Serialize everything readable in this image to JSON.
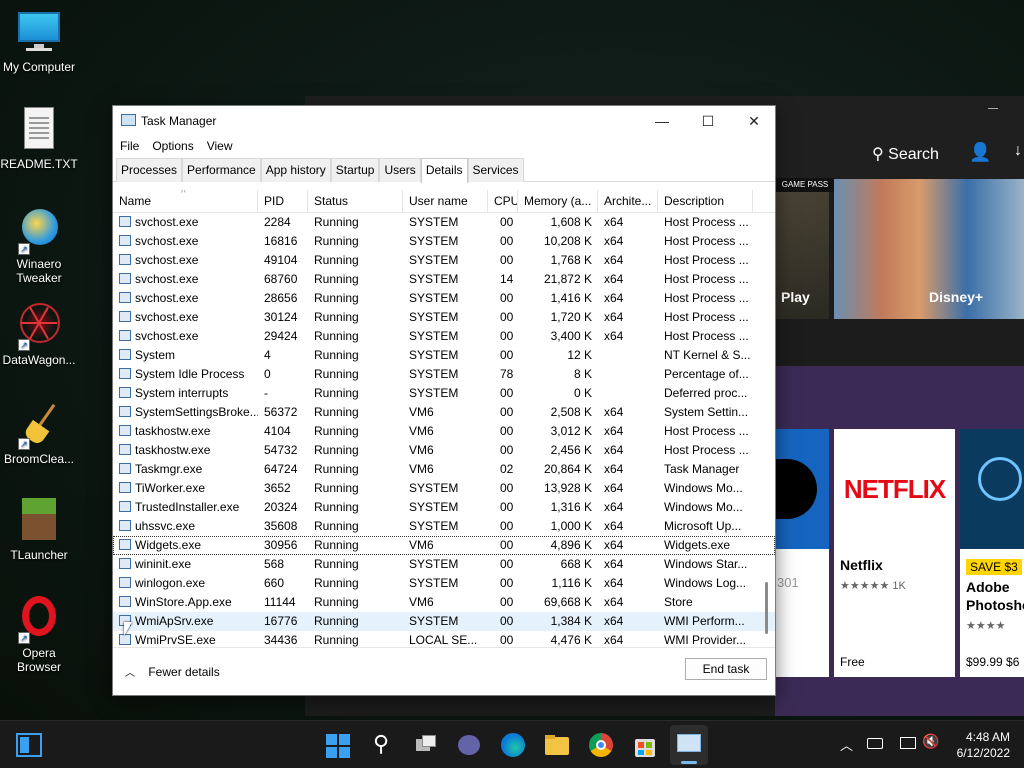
{
  "desktop": {
    "icons": [
      {
        "label": "My Computer"
      },
      {
        "label": "README.TXT"
      },
      {
        "label": "Winaero Tweaker"
      },
      {
        "label": "DataWagon..."
      },
      {
        "label": "BroomClea..."
      },
      {
        "label": "TLauncher"
      },
      {
        "label": "Opera Browser"
      }
    ]
  },
  "store": {
    "search_label": "Search",
    "gamepass_label": "GAME PASS",
    "hero_play": "Play",
    "hero_disney": "Disney+",
    "tile_netflix_logo": "NETFLIX",
    "tile_netflix_name": "Netflix",
    "tile_netflix_rating": "★★★★★ 1K",
    "tile_netflix_price": "Free",
    "tile_adobe_badge": "SAVE $3",
    "tile_adobe_name": "Adobe",
    "tile_adobe_name2": "Photosho",
    "tile_adobe_rating": "★★★★",
    "tile_adobe_price": "$99.99 $6",
    "tile_tiktok_partial": "301"
  },
  "taskmanager": {
    "title": "Task Manager",
    "menu": [
      "File",
      "Options",
      "View"
    ],
    "tabs": [
      "Processes",
      "Performance",
      "App history",
      "Startup",
      "Users",
      "Details",
      "Services"
    ],
    "active_tab": "Details",
    "columns": [
      "Name",
      "PID",
      "Status",
      "User name",
      "CPU",
      "Memory (a...",
      "Archite...",
      "Description"
    ],
    "rows": [
      [
        "svchost.exe",
        "2284",
        "Running",
        "SYSTEM",
        "00",
        "1,608 K",
        "x64",
        "Host Process ..."
      ],
      [
        "svchost.exe",
        "16816",
        "Running",
        "SYSTEM",
        "00",
        "10,208 K",
        "x64",
        "Host Process ..."
      ],
      [
        "svchost.exe",
        "49104",
        "Running",
        "SYSTEM",
        "00",
        "1,768 K",
        "x64",
        "Host Process ..."
      ],
      [
        "svchost.exe",
        "68760",
        "Running",
        "SYSTEM",
        "14",
        "21,872 K",
        "x64",
        "Host Process ..."
      ],
      [
        "svchost.exe",
        "28656",
        "Running",
        "SYSTEM",
        "00",
        "1,416 K",
        "x64",
        "Host Process ..."
      ],
      [
        "svchost.exe",
        "30124",
        "Running",
        "SYSTEM",
        "00",
        "1,720 K",
        "x64",
        "Host Process ..."
      ],
      [
        "svchost.exe",
        "29424",
        "Running",
        "SYSTEM",
        "00",
        "3,400 K",
        "x64",
        "Host Process ..."
      ],
      [
        "System",
        "4",
        "Running",
        "SYSTEM",
        "00",
        "12 K",
        "",
        "NT Kernel & S..."
      ],
      [
        "System Idle Process",
        "0",
        "Running",
        "SYSTEM",
        "78",
        "8 K",
        "",
        "Percentage of..."
      ],
      [
        "System interrupts",
        "-",
        "Running",
        "SYSTEM",
        "00",
        "0 K",
        "",
        "Deferred proc..."
      ],
      [
        "SystemSettingsBroke...",
        "56372",
        "Running",
        "VM6",
        "00",
        "2,508 K",
        "x64",
        "System Settin..."
      ],
      [
        "taskhostw.exe",
        "4104",
        "Running",
        "VM6",
        "00",
        "3,012 K",
        "x64",
        "Host Process ..."
      ],
      [
        "taskhostw.exe",
        "54732",
        "Running",
        "VM6",
        "00",
        "2,456 K",
        "x64",
        "Host Process ..."
      ],
      [
        "Taskmgr.exe",
        "64724",
        "Running",
        "VM6",
        "02",
        "20,864 K",
        "x64",
        "Task Manager"
      ],
      [
        "TiWorker.exe",
        "3652",
        "Running",
        "SYSTEM",
        "00",
        "13,928 K",
        "x64",
        "Windows Mo..."
      ],
      [
        "TrustedInstaller.exe",
        "20324",
        "Running",
        "SYSTEM",
        "00",
        "1,316 K",
        "x64",
        "Windows Mo..."
      ],
      [
        "uhssvc.exe",
        "35608",
        "Running",
        "SYSTEM",
        "00",
        "1,000 K",
        "x64",
        "Microsoft Up..."
      ],
      [
        "Widgets.exe",
        "30956",
        "Running",
        "VM6",
        "00",
        "4,896 K",
        "x64",
        "Widgets.exe"
      ],
      [
        "wininit.exe",
        "568",
        "Running",
        "SYSTEM",
        "00",
        "668 K",
        "x64",
        "Windows Star..."
      ],
      [
        "winlogon.exe",
        "660",
        "Running",
        "SYSTEM",
        "00",
        "1,116 K",
        "x64",
        "Windows Log..."
      ],
      [
        "WinStore.App.exe",
        "11144",
        "Running",
        "VM6",
        "00",
        "69,668 K",
        "x64",
        "Store"
      ],
      [
        "WmiApSrv.exe",
        "16776",
        "Running",
        "SYSTEM",
        "00",
        "1,384 K",
        "x64",
        "WMI Perform..."
      ],
      [
        "WmiPrvSE.exe",
        "34436",
        "Running",
        "LOCAL SE...",
        "00",
        "4,476 K",
        "x64",
        "WMI Provider..."
      ]
    ],
    "selected_row": 17,
    "hovered_row": 21,
    "fewer_details": "Fewer details",
    "end_task": "End task"
  },
  "taskbar": {
    "time": "4:48 AM",
    "date": "6/12/2022"
  },
  "colors": {
    "accent": "#0078d4",
    "selection_hover": "#e5f1fb",
    "store_purple": "#3a2a55",
    "netflix_red": "#e50914"
  }
}
